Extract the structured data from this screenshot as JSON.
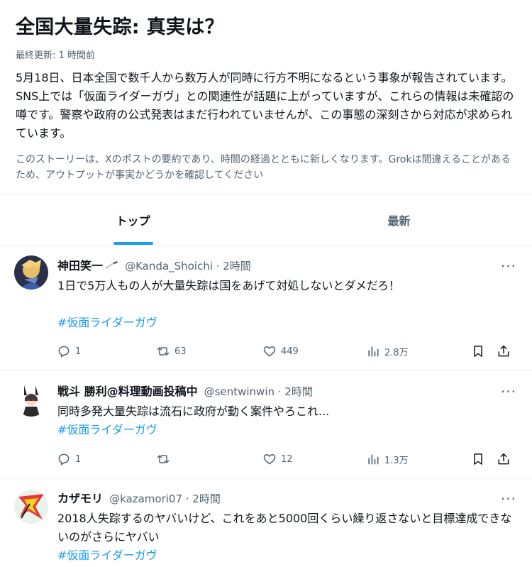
{
  "story": {
    "title": "全国大量失踪: 真実は？",
    "updated": "最終更新: 1 時間前",
    "summary": "5月18日、日本全国で数千人から数万人が同時に行方不明になるという事象が報告されています。SNS上では「仮面ライダーガヴ」との関連性が話題に上がっていますが、これらの情報は未確認の噂です。警察や政府の公式発表はまだ行われていませんが、この事態の深刻さから対応が求められています。",
    "disclaimer": "このストーリーは、Xのポストの要約であり、時間の経過とともに新しくなります。Grokは間違えることがあるため、アウトプットが事実かどうかを確認してください"
  },
  "tabs": [
    {
      "label": "トップ",
      "active": true
    },
    {
      "label": "最新",
      "active": false
    }
  ],
  "posts": [
    {
      "name": "神田笑一",
      "handle": "@Kanda_Shoichi · 2時間",
      "text": "1日で5万人もの人が大量失踪は国をあげて対処しないとダメだろ！",
      "hashtag": "#仮面ライダーガヴ",
      "replies": "1",
      "reposts": "63",
      "likes": "449",
      "views": "2.8万",
      "more": "···"
    },
    {
      "name": "戦斗 勝利@料理動画投稿中",
      "handle": "@sentwinwin · 2時間",
      "text": "同時多発大量失踪は流石に政府が動く案件やろこれ...",
      "hashtag": "#仮面ライダーガヴ",
      "replies": "1",
      "reposts": "",
      "likes": "12",
      "views": "1.3万",
      "more": "···"
    },
    {
      "name": "カザモリ",
      "handle": "@kazamori07 · 2時間",
      "text": "2018人失踪するのヤバいけど、これをあと5000回くらい繰り返さないと目標達成できないのがさらにヤバい",
      "hashtag": "#仮面ライダーガヴ",
      "more": "···"
    }
  ],
  "icons": {
    "reply": "reply-icon",
    "repost": "repost-icon",
    "like": "heart-icon",
    "views": "views-icon",
    "bookmark": "bookmark-icon",
    "share": "share-icon"
  },
  "colors": {
    "accent": "#1d9bf0",
    "secondary_text": "#536471",
    "divider": "#eff3f4"
  }
}
